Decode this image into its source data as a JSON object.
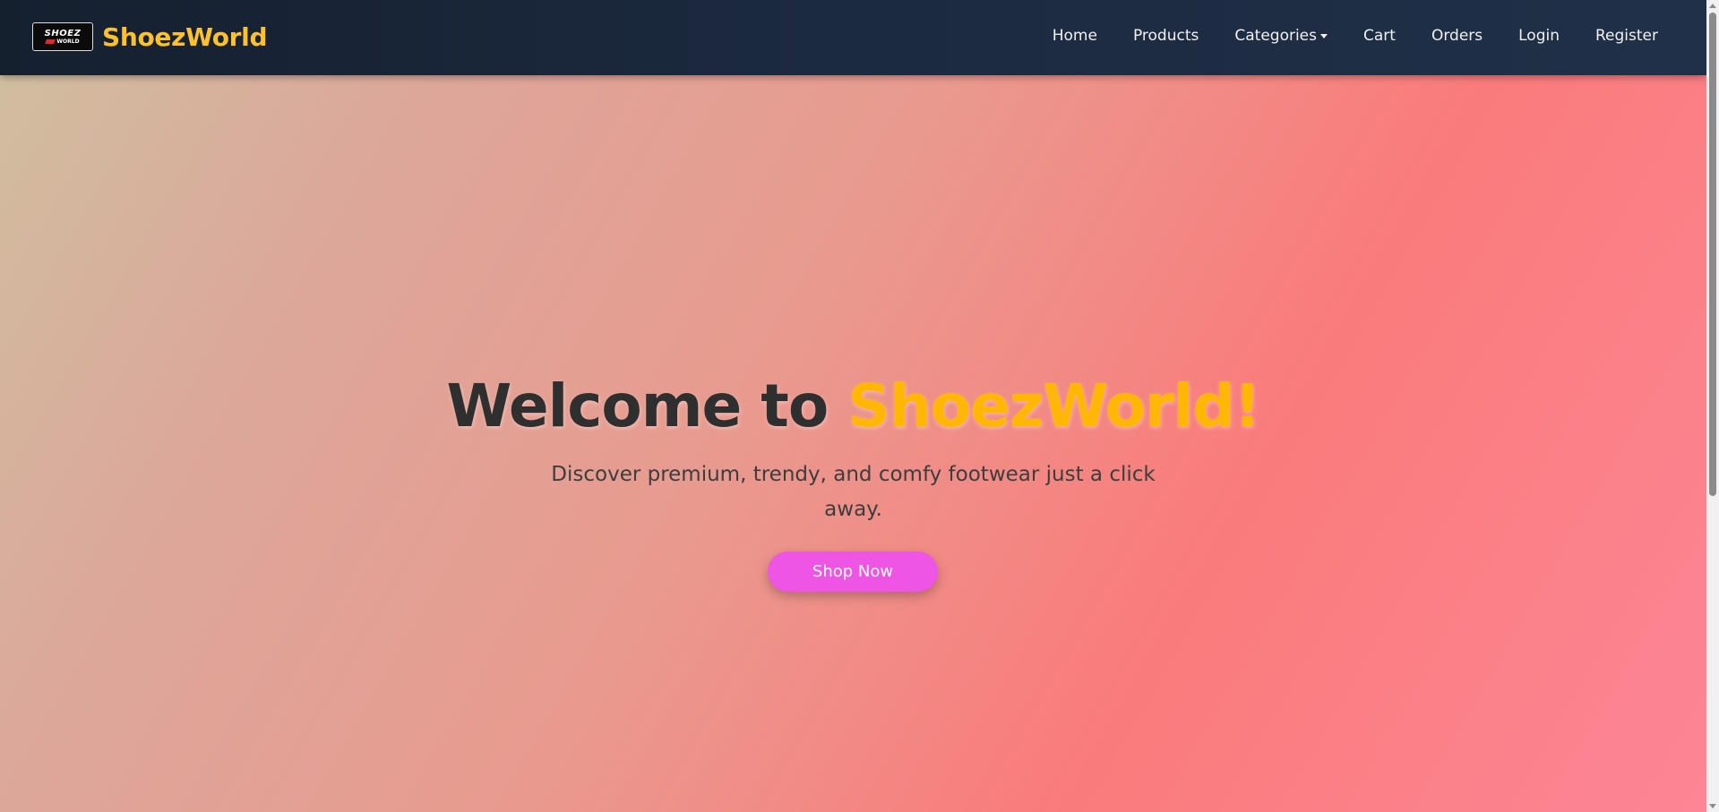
{
  "navbar": {
    "logo": {
      "line1": "SHOEZ",
      "line2": "WORLD"
    },
    "brand": "ShoezWorld",
    "items": [
      {
        "label": "Home"
      },
      {
        "label": "Products"
      },
      {
        "label": "Categories",
        "dropdown": true
      },
      {
        "label": "Cart"
      },
      {
        "label": "Orders"
      },
      {
        "label": "Login"
      },
      {
        "label": "Register"
      }
    ]
  },
  "hero": {
    "title_prefix": "Welcome to ",
    "title_accent": "ShoezWorld!",
    "subtitle": "Discover premium, trendy, and comfy footwear just a click away.",
    "cta_label": "Shop Now"
  },
  "colors": {
    "accent": "#ffb703",
    "brand_text": "#ffc12d",
    "cta": "#ee55e4",
    "navbar": "#1c2a40"
  }
}
